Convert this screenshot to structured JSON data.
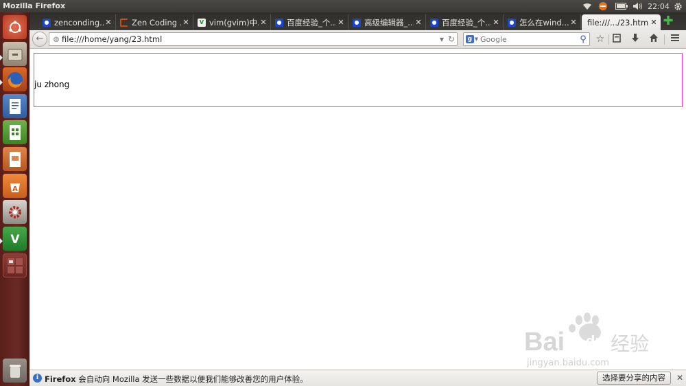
{
  "window": {
    "title": "Mozilla Firefox"
  },
  "tray": {
    "time": "22:04"
  },
  "launcher": {
    "items": [
      "dash",
      "files",
      "firefox",
      "writer",
      "calc",
      "impress",
      "software-center",
      "settings",
      "vim",
      "workspaces",
      "trash"
    ]
  },
  "tabs": [
    {
      "label": "zenconding...",
      "favicon": "paw"
    },
    {
      "label": "Zen Coding ...",
      "favicon": "loading"
    },
    {
      "label": "vim(gvim)中...",
      "favicon": "vim"
    },
    {
      "label": "百度经验_个...",
      "favicon": "paw"
    },
    {
      "label": "高级编辑器_...",
      "favicon": "paw"
    },
    {
      "label": "百度经验_个...",
      "favicon": "paw"
    },
    {
      "label": "怎么在wind...",
      "favicon": "paw"
    },
    {
      "label": "file:///.../23.html",
      "favicon": "none",
      "active": true
    }
  ],
  "navbar": {
    "url": "file:///home/yang/23.html",
    "search_placeholder": "Google",
    "search_engine_letter": "g"
  },
  "page": {
    "text": "ju zhong"
  },
  "notification": {
    "brand": "Firefox",
    "message": " 会自动向 Mozilla 发送一些数据以便我们能够改善您的用户体验。",
    "button": "选择要分享的内容(C)"
  },
  "watermark": {
    "brand": "Bai",
    "brand2": "du",
    "brand_cn": "经验",
    "url": "jingyan.baidu.com"
  },
  "colors": {
    "accent_box": "#ff33cc",
    "launcher": "#5e221d"
  }
}
